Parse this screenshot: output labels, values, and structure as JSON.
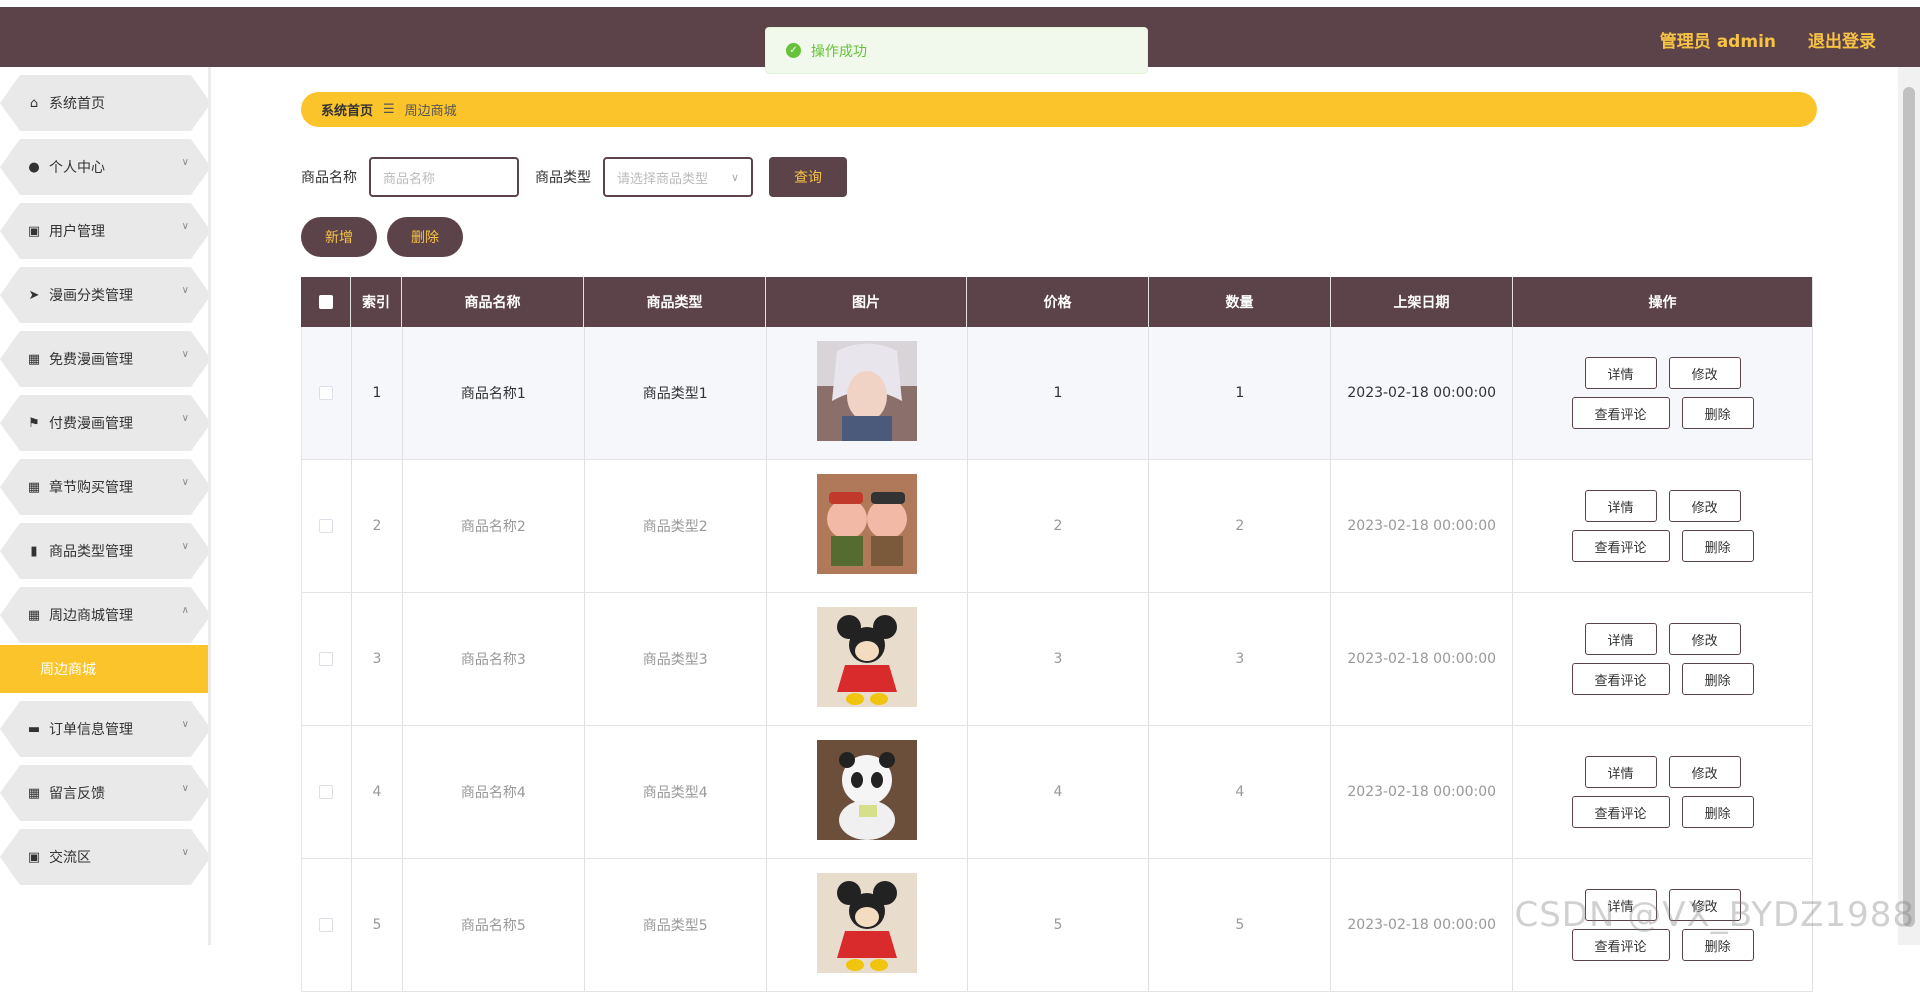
{
  "header": {
    "user_label": "管理员 admin",
    "logout_label": "退出登录"
  },
  "toast": {
    "message": "操作成功"
  },
  "sidebar": {
    "items": [
      {
        "label": "系统首页",
        "icon": "home-icon",
        "glyph": "⌂",
        "has_chevron": false
      },
      {
        "label": "个人中心",
        "icon": "user-icon",
        "glyph": "●",
        "has_chevron": true
      },
      {
        "label": "用户管理",
        "icon": "clipboard-icon",
        "glyph": "▣",
        "has_chevron": true
      },
      {
        "label": "漫画分类管理",
        "icon": "send-icon",
        "glyph": "➤",
        "has_chevron": true
      },
      {
        "label": "免费漫画管理",
        "icon": "grid-icon",
        "glyph": "▦",
        "has_chevron": true
      },
      {
        "label": "付费漫画管理",
        "icon": "flag-icon",
        "glyph": "⚑",
        "has_chevron": true
      },
      {
        "label": "章节购买管理",
        "icon": "grid-icon",
        "glyph": "▦",
        "has_chevron": true
      },
      {
        "label": "商品类型管理",
        "icon": "book-icon",
        "glyph": "▮",
        "has_chevron": true
      },
      {
        "label": "周边商城管理",
        "icon": "grid-icon",
        "glyph": "▦",
        "has_chevron": true,
        "expanded": true
      }
    ],
    "active_sub": "周边商城",
    "items_after": [
      {
        "label": "订单信息管理",
        "icon": "chat-icon",
        "glyph": "▬",
        "has_chevron": true
      },
      {
        "label": "留言反馈",
        "icon": "apps-icon",
        "glyph": "▦",
        "has_chevron": true
      },
      {
        "label": "交流区",
        "icon": "checklist-icon",
        "glyph": "▣",
        "has_chevron": true
      }
    ]
  },
  "breadcrumb": {
    "home": "系统首页",
    "separator": "☰",
    "current": "周边商城"
  },
  "search": {
    "name_label": "商品名称",
    "name_placeholder": "商品名称",
    "type_label": "商品类型",
    "type_placeholder": "请选择商品类型",
    "query_label": "查询"
  },
  "actions": {
    "add_label": "新增",
    "delete_label": "删除"
  },
  "table": {
    "headers": [
      "索引",
      "商品名称",
      "商品类型",
      "图片",
      "价格",
      "数量",
      "上架日期",
      "操作"
    ],
    "ops": {
      "detail": "详情",
      "edit": "修改",
      "comments": "查看评论",
      "delete": "删除"
    },
    "rows": [
      {
        "index": "1",
        "name": "商品名称1",
        "type": "商品类型1",
        "price": "1",
        "qty": "1",
        "date": "2023-02-18 00:00:00",
        "image": "anime-portrait"
      },
      {
        "index": "2",
        "name": "商品名称2",
        "type": "商品类型2",
        "price": "2",
        "qty": "2",
        "date": "2023-02-18 00:00:00",
        "image": "pig-plush"
      },
      {
        "index": "3",
        "name": "商品名称3",
        "type": "商品类型3",
        "price": "3",
        "qty": "3",
        "date": "2023-02-18 00:00:00",
        "image": "minnie-plush"
      },
      {
        "index": "4",
        "name": "商品名称4",
        "type": "商品类型4",
        "price": "4",
        "qty": "4",
        "date": "2023-02-18 00:00:00",
        "image": "panda-plush"
      },
      {
        "index": "5",
        "name": "商品名称5",
        "type": "商品类型5",
        "price": "5",
        "qty": "5",
        "date": "2023-02-18 00:00:00",
        "image": "minnie-plush"
      }
    ]
  },
  "watermark": "CSDN @VX_BYDZ1988"
}
